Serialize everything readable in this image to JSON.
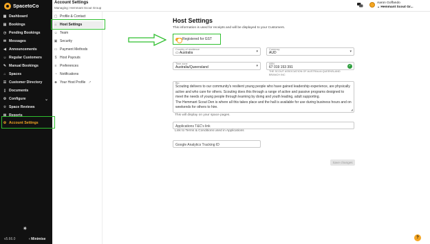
{
  "app": {
    "logo_text": "SpacetoCo",
    "version": "v5.66.0",
    "minimise_label": "Minimise"
  },
  "header": {
    "title": "Account Settings",
    "subtitle": "Managing: Hemmant Scout Group"
  },
  "user": {
    "name": "Aaron Goffando",
    "org": "Hemmant Scout Gr..."
  },
  "sidebar": {
    "items": [
      {
        "label": "Dashboard",
        "icon": "dashboard-icon"
      },
      {
        "label": "Bookings",
        "icon": "calendar-icon"
      },
      {
        "label": "Pending Bookings",
        "icon": "clock-icon"
      },
      {
        "label": "Messages",
        "icon": "mail-icon"
      },
      {
        "label": "Announcements",
        "icon": "megaphone-icon"
      },
      {
        "label": "Regular Customers",
        "icon": "users-icon"
      },
      {
        "label": "Manual Bookings",
        "icon": "edit-icon"
      },
      {
        "label": "Spaces",
        "icon": "home-icon"
      },
      {
        "label": "Customer Directory",
        "icon": "contacts-icon"
      },
      {
        "label": "Documents",
        "icon": "document-icon"
      },
      {
        "label": "Configure",
        "icon": "settings-icon"
      },
      {
        "label": "Space Reviews",
        "icon": "star-icon"
      },
      {
        "label": "Reports",
        "icon": "chart-icon"
      },
      {
        "label": "Account Settings",
        "icon": "gear-icon"
      }
    ]
  },
  "subnav": {
    "items": [
      {
        "label": "Profile & Contact",
        "icon": "profile-icon"
      },
      {
        "label": "Host Settings",
        "icon": "home-icon"
      },
      {
        "label": "Team",
        "icon": "team-icon"
      },
      {
        "label": "Security",
        "icon": "lock-icon"
      },
      {
        "label": "Payment Methods",
        "icon": "card-icon"
      },
      {
        "label": "Host Payouts",
        "icon": "payout-icon"
      },
      {
        "label": "Preferences",
        "icon": "sliders-icon"
      },
      {
        "label": "Notifications",
        "icon": "bell-icon"
      },
      {
        "label": "Your Host Profile",
        "icon": "user-icon"
      }
    ]
  },
  "main": {
    "title": "Host Settings",
    "description": "This information is used for receipts and will be displayed to your Customers.",
    "gst_label": "Registered for GST",
    "gst_enabled": true,
    "country": {
      "label": "Country of residence",
      "value": "Australia"
    },
    "currency": {
      "label": "Currency",
      "value": "AUD"
    },
    "timezone": {
      "label": "Time zone",
      "value": "Australia/Queensland"
    },
    "abn": {
      "label": "ABN",
      "value": "67 019 153 391",
      "note": "THE SCOUT ASSOCIATION OF AUSTRALIA QUEENSLAND BRANCH INC"
    },
    "bio": {
      "label": "Bio",
      "text": "Scouting delivers to our community's resilient young people who have gained leadership experience, are physically active and who care for others. Scouting does this through a range of active and passive programs designed to meet the needs of young people through learning by doing and youth leading, adult supporting.\nThe Hemmant Scout Den is where all this takes place and the hall is available for use during business hours and on weekends for others to hire."
    },
    "bio_hint": "This will display on your space pages.",
    "tc_placeholder": "Applications T&C's link",
    "tc_hint": "Link to Terms & Conditions used in Applications",
    "ga_placeholder": "Google Analytics Tracking ID",
    "save_label": "Save changes"
  },
  "colors": {
    "accent": "#f5a623",
    "sidebar_bg": "#111111",
    "annotation": "#2fbf2f",
    "success": "#2e9e3e"
  }
}
